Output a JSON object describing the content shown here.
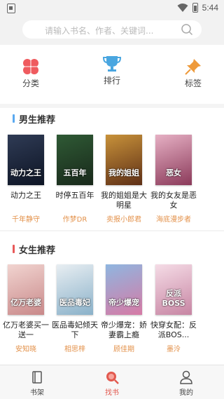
{
  "status_bar": {
    "time": "5:44"
  },
  "search": {
    "placeholder": "请输入书名、作者、关键词..."
  },
  "categories": [
    {
      "label": "分类",
      "icon": "clover-icon"
    },
    {
      "label": "排行",
      "icon": "trophy-icon"
    },
    {
      "label": "标签",
      "icon": "pin-icon"
    }
  ],
  "sections": [
    {
      "title": "男生推荐",
      "accent": "#5aa9f0",
      "books": [
        {
          "cover_text": "动力之王",
          "title": "动力之王",
          "author": "千年静守",
          "cover_colors": [
            "#2f3b55",
            "#0d1424"
          ]
        },
        {
          "cover_text": "五百年",
          "title": "时停五百年",
          "author": "作梦DR",
          "cover_colors": [
            "#2f5a35",
            "#18281a"
          ]
        },
        {
          "cover_text": "我的姐姐",
          "title": "我的姐姐是大明星",
          "author": "卖报小郎君",
          "cover_colors": [
            "#c8923a",
            "#5e2f16"
          ]
        },
        {
          "cover_text": "恶女",
          "title": "我的女友是恶女",
          "author": "海底漫步者",
          "cover_colors": [
            "#e6b0c4",
            "#8b3a5a"
          ]
        }
      ]
    },
    {
      "title": "女生推荐",
      "accent": "#e85a5a",
      "books": [
        {
          "cover_text": "亿万老婆",
          "title": "亿万老婆买一送一",
          "author": "安知晓",
          "cover_colors": [
            "#f1d4d0",
            "#c9898a"
          ]
        },
        {
          "cover_text": "医品毒妃",
          "title": "医品毒妃倾天下",
          "author": "相思梓",
          "cover_colors": [
            "#e8eef2",
            "#8ab1c9"
          ]
        },
        {
          "cover_text": "帝少爆宠",
          "title": "帝少爆宠：娇妻霸上瘾",
          "author": "顾佳期",
          "cover_colors": [
            "#8fb6e0",
            "#d67aa5"
          ]
        },
        {
          "cover_text": "反派BOSS",
          "title": "快穿女配：反派BOS...",
          "author": "墨泠",
          "cover_colors": [
            "#f5dce6",
            "#c785a3"
          ]
        }
      ]
    }
  ],
  "tabs": [
    {
      "label": "书架",
      "icon": "bookshelf-icon",
      "active": false
    },
    {
      "label": "找书",
      "icon": "find-book-icon",
      "active": true
    },
    {
      "label": "我的",
      "icon": "profile-icon",
      "active": false
    }
  ],
  "colors": {
    "active": "#e2594f",
    "inactive": "#444444",
    "author": "#e3914a"
  }
}
